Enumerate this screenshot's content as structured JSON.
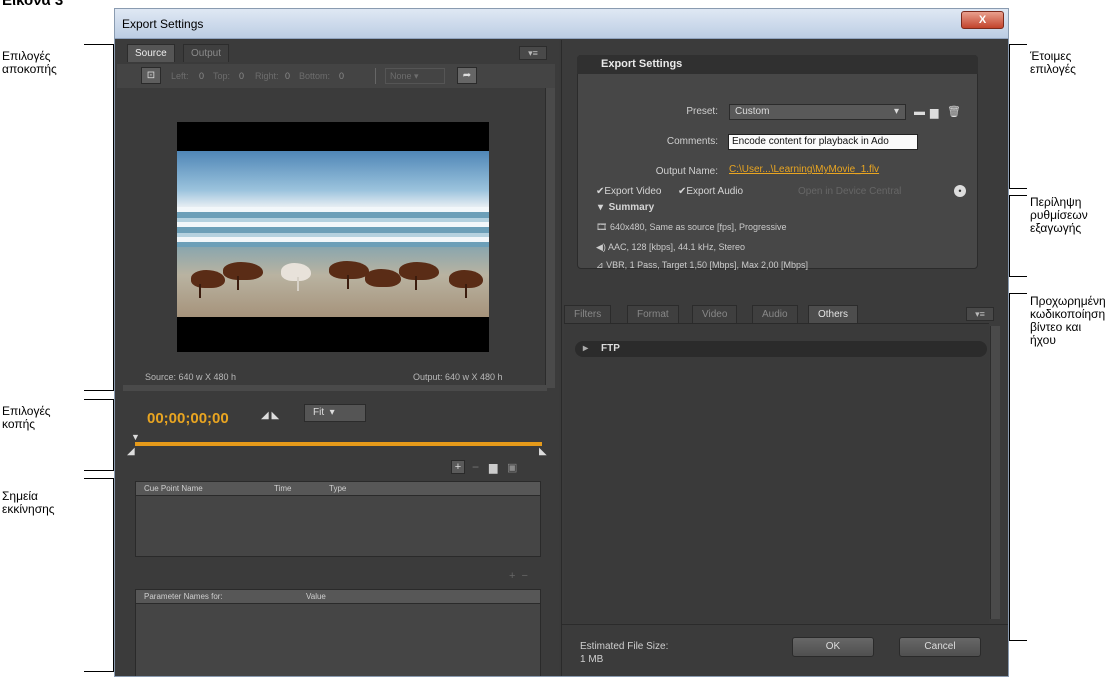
{
  "caption": "Εικόνα 3",
  "annotations": {
    "crop_options": "Επιλογές\nαποκοπής",
    "trim_options": "Επιλογές\nκοπής",
    "cue_points": "Σημεία\nεκκίνησης",
    "presets": "Έτοιμες\nεπιλογές",
    "summary": "Περίληψη\nρυθμίσεων\nεξαγωγής",
    "advanced": "Προχωρημένη\nκωδικοποίηση\nβίντεο και\nήχου"
  },
  "window": {
    "title": "Export Settings",
    "close_label": "X"
  },
  "left": {
    "tabs": [
      "Source",
      "Output"
    ],
    "crop_labels": [
      "Left:",
      "Top:",
      "Right:",
      "Bottom:"
    ],
    "crop_values": [
      "0",
      "0",
      "0",
      "0"
    ],
    "ratio_label": "None",
    "source_size": "Source: 640 w X 480 h",
    "output_size": "Output: 640 w X 480 h",
    "timecode": "00;00;00;00",
    "fit_label": "Fit",
    "cue_table": {
      "headers": [
        "Cue Point Name",
        "Time",
        "Type"
      ]
    },
    "param_table": {
      "headers": [
        "Parameter Names for:",
        "Value"
      ]
    }
  },
  "right": {
    "section_title": "Export Settings",
    "preset_label": "Preset:",
    "preset_value": "Custom",
    "comments_label": "Comments:",
    "comments_value": "Encode content for playback in Ado",
    "output_name_label": "Output Name:",
    "output_name_value": "C:\\User...\\Learning\\MyMovie_1.flv",
    "export_video": "Export Video",
    "export_audio": "Export Audio",
    "device_central": "Open in Device Central",
    "summary_title": "Summary",
    "summary_lines": [
      "640x480, Same as source [fps], Progressive",
      "AAC, 128 [kbps], 44.1 kHz, Stereo",
      "VBR, 1 Pass, Target 1,50 [Mbps], Max 2,00 [Mbps]"
    ],
    "tabs": [
      "Filters",
      "Format",
      "Video",
      "Audio",
      "Others"
    ],
    "ftp_label": "FTP",
    "estimated_label": "Estimated File Size:",
    "estimated_value": "1 MB",
    "ok_label": "OK",
    "cancel_label": "Cancel"
  },
  "colors": {
    "accent": "#e9a521",
    "panel": "#3b3b3b"
  }
}
